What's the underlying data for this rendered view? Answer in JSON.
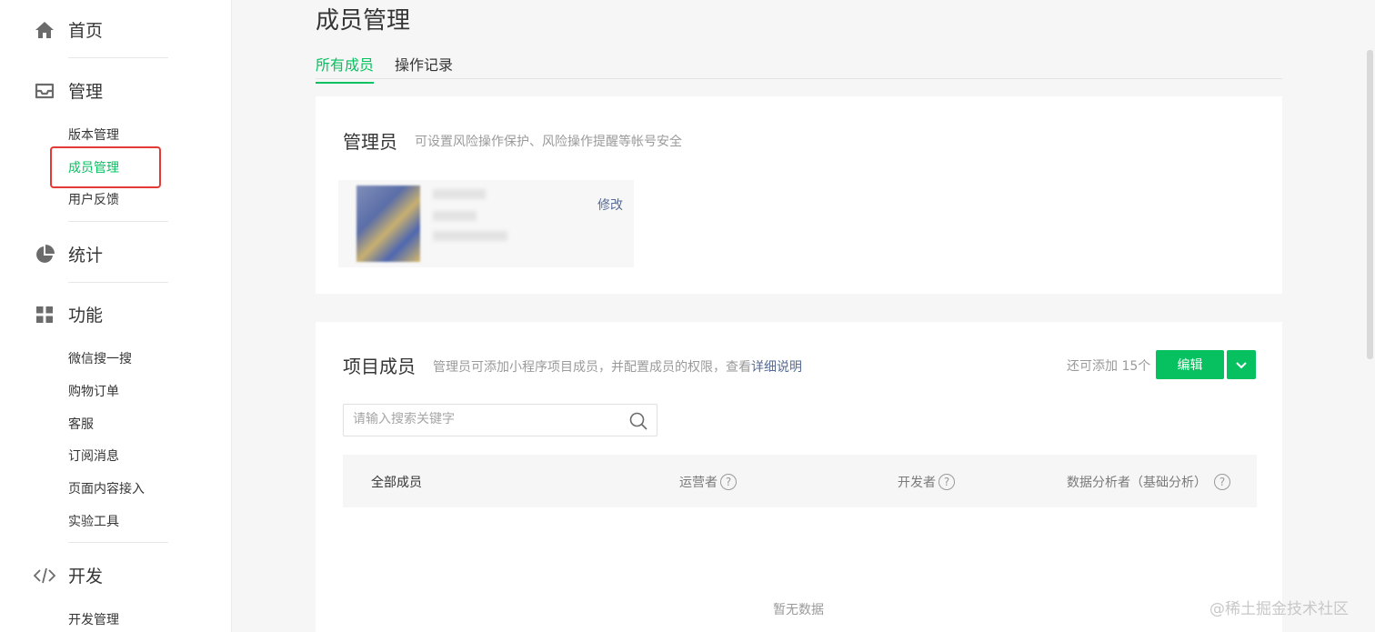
{
  "sidebar": {
    "home": "首页",
    "manage": "管理",
    "manage_items": [
      "版本管理",
      "成员管理",
      "用户反馈"
    ],
    "stats": "统计",
    "features": "功能",
    "feature_items": [
      "微信搜一搜",
      "购物订单",
      "客服",
      "订阅消息",
      "页面内容接入",
      "实验工具"
    ],
    "dev": "开发",
    "dev_items": [
      "开发管理"
    ]
  },
  "page": {
    "title": "成员管理",
    "tabs": [
      "所有成员",
      "操作记录"
    ]
  },
  "admin": {
    "title": "管理员",
    "desc": "可设置风险操作保护、风险操作提醒等帐号安全",
    "edit": "修改"
  },
  "members": {
    "title": "项目成员",
    "desc_prefix": "管理员可添加小程序项目成员，并配置成员的权限，查看",
    "desc_link": "详细说明",
    "quota": "还可添加 15个",
    "edit_btn": "编辑",
    "search_placeholder": "请输入搜索关键字",
    "columns": [
      "全部成员",
      "运营者",
      "开发者",
      "数据分析者（基础分析）"
    ],
    "empty": "暂无数据"
  },
  "watermark": "@稀土掘金技术社区",
  "colors": {
    "accent": "#07c160",
    "link": "#576b95",
    "highlight": "#e53935"
  }
}
